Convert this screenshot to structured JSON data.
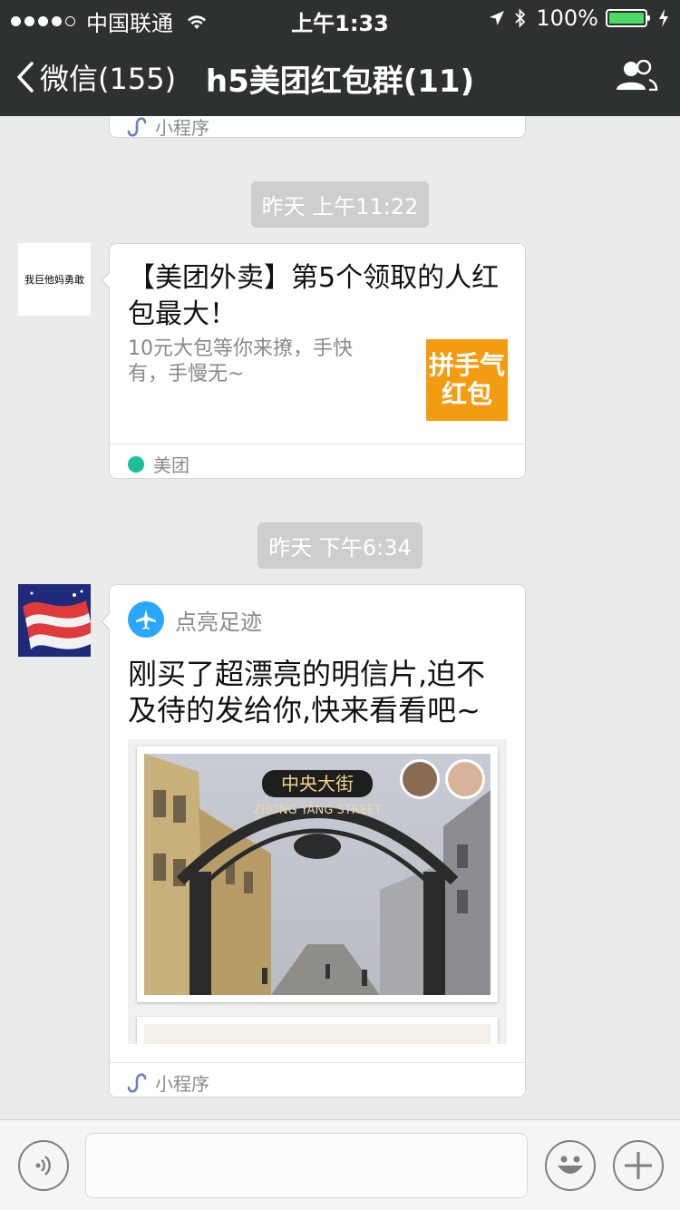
{
  "status_bar": {
    "carrier": "中国联通",
    "time": "上午1:33",
    "battery": "100%",
    "battery_color": "#4cd964",
    "icons": [
      "signal-dots",
      "wifi-icon",
      "location-icon",
      "bluetooth-icon",
      "battery-icon",
      "charging-icon"
    ]
  },
  "nav": {
    "back_label": "微信(155)",
    "title": "h5美团红包群(11)",
    "group_icon": "group-members-icon"
  },
  "chat": {
    "top_partial": {
      "footer_label": "小程序"
    },
    "messages": [
      {
        "timestamp": "昨天 上午11:22",
        "avatar_text": "我巨他妈勇敢",
        "card": {
          "title": "【美团外卖】第5个领取的人红包最大！",
          "description": "10元大包等你来撩，手快有，手慢无~",
          "thumb_text": [
            "拼手气",
            "红包"
          ],
          "thumb_color": "#f39c12",
          "source": "美团",
          "source_color": "#1bbf99"
        }
      },
      {
        "timestamp": "昨天 下午6:34",
        "avatar_icon": "flag-avatar",
        "card": {
          "app_name": "点亮足迹",
          "app_color": "#2ba6ff",
          "text": "刚买了超漂亮的明信片,迫不及待的发给你,快来看看吧~",
          "image_sign_text": "中央大街",
          "image_subtext": "ZHONG YANG STREET",
          "footer_label": "小程序"
        }
      }
    ]
  },
  "input_bar": {
    "voice_icon": "voice-icon",
    "emoji_icon": "emoji-icon",
    "plus_icon": "plus-icon",
    "input_value": ""
  }
}
